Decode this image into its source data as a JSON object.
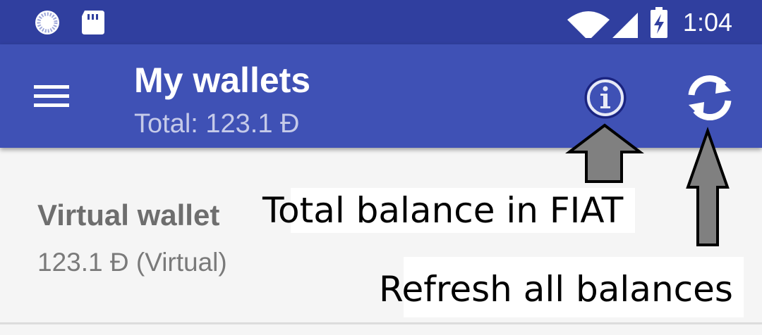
{
  "status_bar": {
    "time": "1:04",
    "icons": [
      "sync-status-icon",
      "sd-card-icon",
      "wifi-icon",
      "cell-signal-icon",
      "battery-charging-icon"
    ]
  },
  "app_bar": {
    "title": "My wallets",
    "subtitle": "Total: 123.1 Đ",
    "icons": [
      "menu-icon",
      "info-icon",
      "refresh-icon"
    ]
  },
  "wallets": [
    {
      "name": "Virtual wallet",
      "balance": "123.1 Đ (Virtual)"
    }
  ],
  "annotations": {
    "info_label": "Total balance in FIAT",
    "refresh_label": "Refresh all balances"
  },
  "colors": {
    "status_bar": "#303f9f",
    "app_bar": "#3f51b5",
    "subtitle": "#c5cae9",
    "background": "#f5f5f5"
  }
}
